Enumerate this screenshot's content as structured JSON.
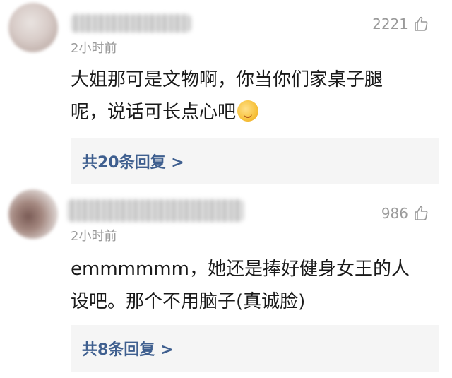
{
  "comments": [
    {
      "time": "2小时前",
      "likes": "2221",
      "text_line1": "大姐那可是文物啊，你当你们家桌子腿",
      "text_line2": "呢，说话可长点心吧",
      "replies": "共20条回复 >"
    },
    {
      "time": "2小时前",
      "likes": "986",
      "text_line1": "emmmmmm，她还是捧好健身女王的人",
      "text_line2": "设吧。那个不用脑子(真诚脸)",
      "replies": "共8条回复 >"
    }
  ],
  "icons": {
    "like": "thumbs-up-icon",
    "emoji": "drooling-face-emoji"
  },
  "colors": {
    "reply_link": "#3f5f8f",
    "meta_text": "#9a9a9a",
    "reply_bg": "#f5f5f5"
  }
}
